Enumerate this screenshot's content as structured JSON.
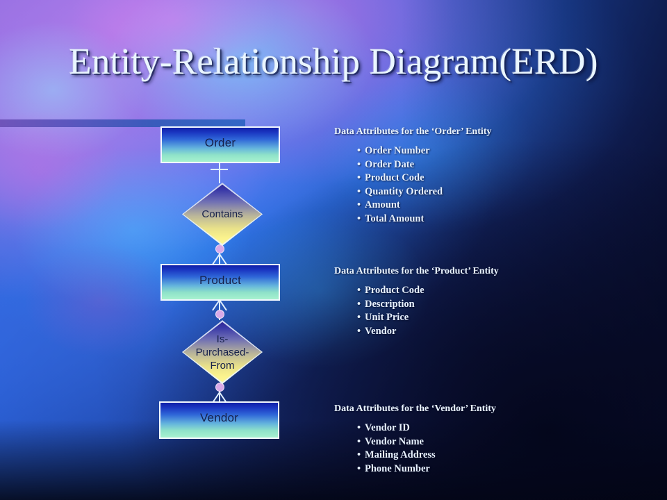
{
  "slide": {
    "title": "Entity-Relationship Diagram(ERD)",
    "accent_bar_color": "#5350b9"
  },
  "diagram": {
    "entities": [
      {
        "id": "order",
        "label": "Order"
      },
      {
        "id": "product",
        "label": "Product"
      },
      {
        "id": "vendor",
        "label": "Vendor"
      }
    ],
    "relationships": [
      {
        "id": "contains",
        "label": "Contains"
      },
      {
        "id": "purchased",
        "label": "Is-\nPurchased-\nFrom"
      }
    ],
    "connectors": [
      {
        "from": "order",
        "to": "contains",
        "from_cardinality": "one",
        "to_cardinality": "one"
      },
      {
        "from": "contains",
        "to": "product",
        "from_cardinality": "zero",
        "to_cardinality": "many"
      },
      {
        "from": "product",
        "to": "purchased",
        "from_cardinality": "many",
        "to_cardinality": "zero"
      },
      {
        "from": "purchased",
        "to": "vendor",
        "from_cardinality": "zero",
        "to_cardinality": "many"
      }
    ],
    "colors": {
      "entity_fill_top": "#0f1fa8",
      "entity_fill_bottom": "#a7f2cf",
      "relationship_fill_top": "#2a1d8f",
      "relationship_fill_bottom": "#fdf79a",
      "connector_line": "#dfeeff",
      "cardinality_circle": "#d9a9e8",
      "shape_border": "#f2f8ff",
      "shape_label_text": "#16204a"
    }
  },
  "attribute_blocks": [
    {
      "id": "order",
      "heading": "Data Attributes for the ‘Order’ Entity",
      "items": [
        "Order Number",
        "Order Date",
        "Product Code",
        "Quantity Ordered",
        "Amount",
        "Total Amount"
      ]
    },
    {
      "id": "product",
      "heading": "Data Attributes for the ‘Product’ Entity",
      "items": [
        "Product Code",
        "Description",
        "Unit Price",
        "Vendor"
      ]
    },
    {
      "id": "vendor",
      "heading": "Data Attributes for the ‘Vendor’ Entity",
      "items": [
        "Vendor ID",
        "Vendor Name",
        "Mailing Address",
        "Phone Number"
      ]
    }
  ]
}
